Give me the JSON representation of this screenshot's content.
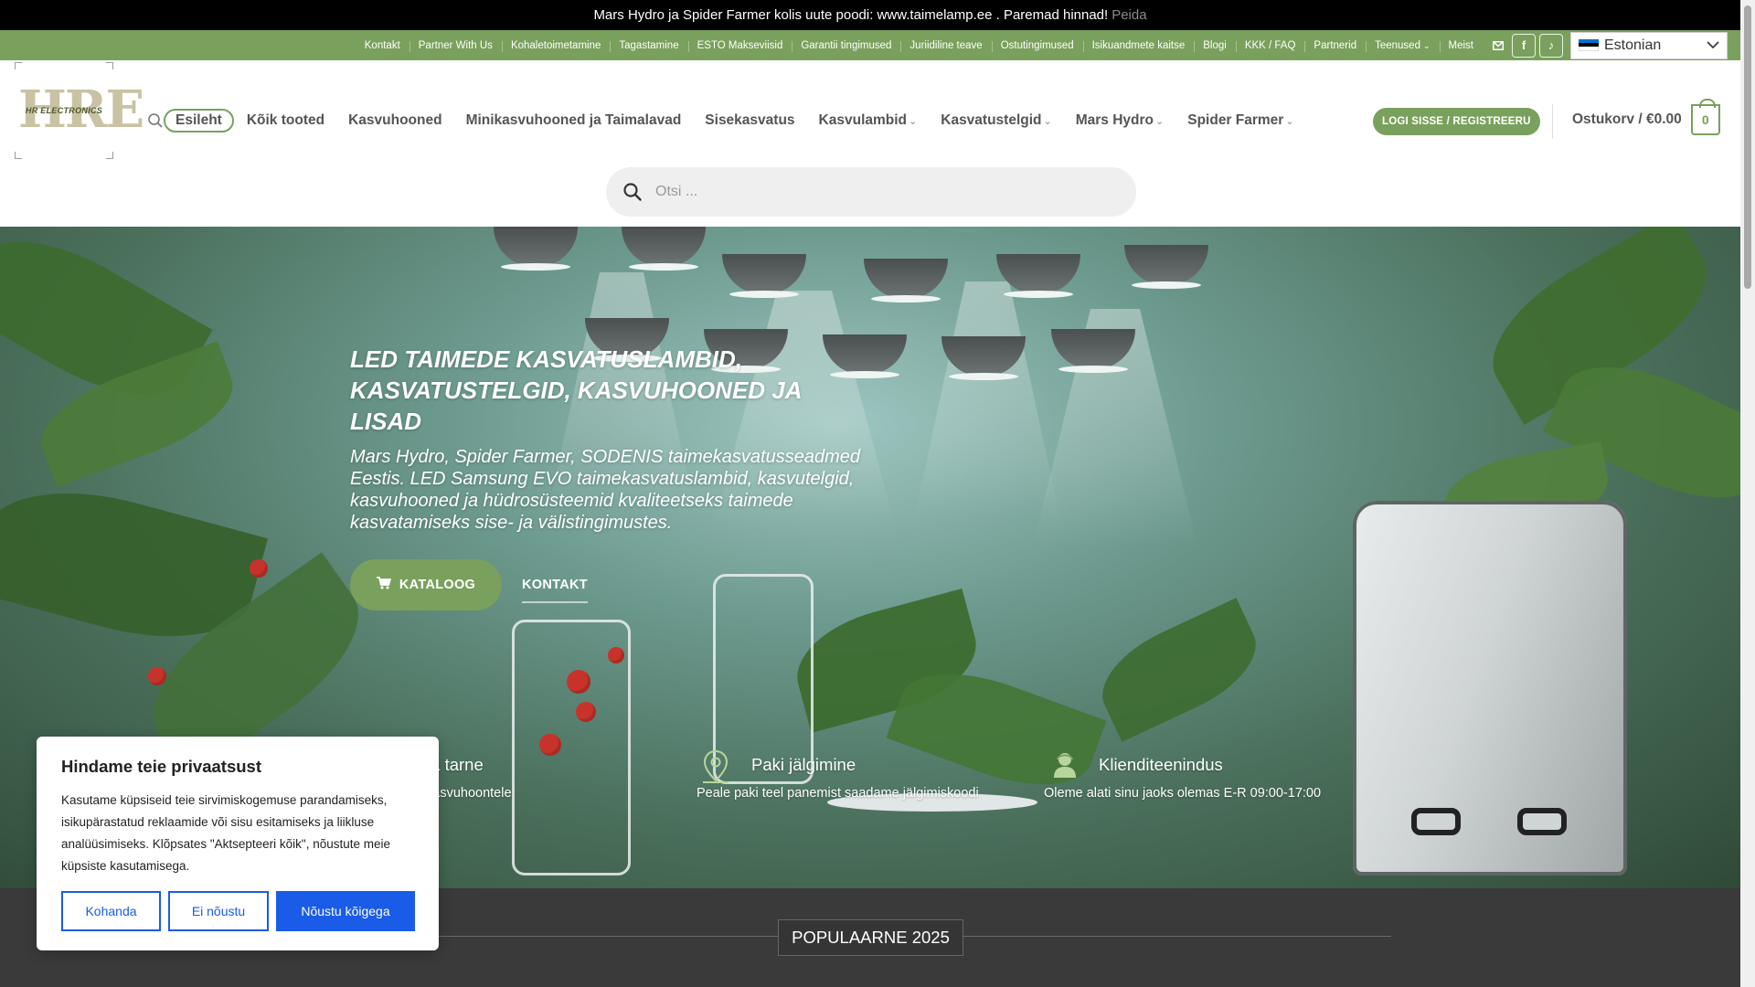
{
  "announcement": {
    "text": "Mars Hydro ja Spider Farmer kolis uute poodi: www.taimelamp.ee . Paremad hinnad!",
    "dismiss": "Peida"
  },
  "topbar": {
    "items": [
      "Kontakt",
      "Partner With Us",
      "Kohaletoimetamine",
      "Tagastamine",
      "ESTO Makseviisid",
      "Garantii tingimused",
      "Juriidiline teave",
      "Ostutingimused",
      "Isikuandmete kaitse",
      "Blogi",
      "KKK / FAQ",
      "Partnerid",
      "Teenused",
      "Meist"
    ],
    "language": "Estonian",
    "flag_colors": [
      "#0072ce",
      "#000000",
      "#ffffff"
    ]
  },
  "logo": {
    "mark": "HRE",
    "subtitle": "HR ELECTRONICS"
  },
  "nav": {
    "items": [
      "Esileht",
      "Kõik tooted",
      "Kasvuhooned",
      "Minikasvuhooned ja Taimalavad",
      "Sisekasvatus",
      "Kasvulambid",
      "Kasvatustelgid",
      "Mars Hydro",
      "Spider Farmer"
    ],
    "active": "Esileht",
    "login": "LOGI SISSE / REGISTREERU",
    "cart_label": "Ostukorv / €0.00",
    "cart_count": "0"
  },
  "search": {
    "placeholder": "Otsi ..."
  },
  "hero": {
    "title": "LED TAIMEDE KASVATUSLAMBID, KASVATUSTELGID, KASVUHOONED JA LISAD",
    "subtitle": "Mars Hydro, Spider Farmer, SODENIS taimekasvatusseadmed Eestis. LED Samsung EVO taimekasvatuslambid, kasvutelgid, kasvuhooned ja hüdrosüsteemid kvaliteetseks taimede kasvatamiseks sise- ja välistingimustes.",
    "btn_catalog": "KATALOOG",
    "btn_contact": "KONTAKT"
  },
  "features": [
    {
      "title": "ta tarne",
      "text": "kasvuhoontele"
    },
    {
      "title": "Paki jälgimine",
      "text": "Peale paki teel panemist saadame jälgimiskoodi"
    },
    {
      "title": "Klienditeenindus",
      "text": "Oleme alati sinu jaoks olemas E-R 09:00-17:00"
    }
  ],
  "section": {
    "title": "POPULAARNE 2025"
  },
  "cookie": {
    "title": "Hindame teie privaatsust",
    "text": "Kasutame küpsiseid teie sirvimiskogemuse parandamiseks, isikupärastatud reklaamide või sisu esitamiseks ja liikluse analüüsimiseks. Klõpsates \"Aktsepteeri kõik\", nõustute meie küpsiste kasutamisega.",
    "btn_customize": "Kohanda",
    "btn_reject": "Ei nõustu",
    "btn_accept": "Nõustu kõigega"
  },
  "colors": {
    "brand_green": "#7aa05d",
    "cookie_blue": "#1a5be8"
  }
}
